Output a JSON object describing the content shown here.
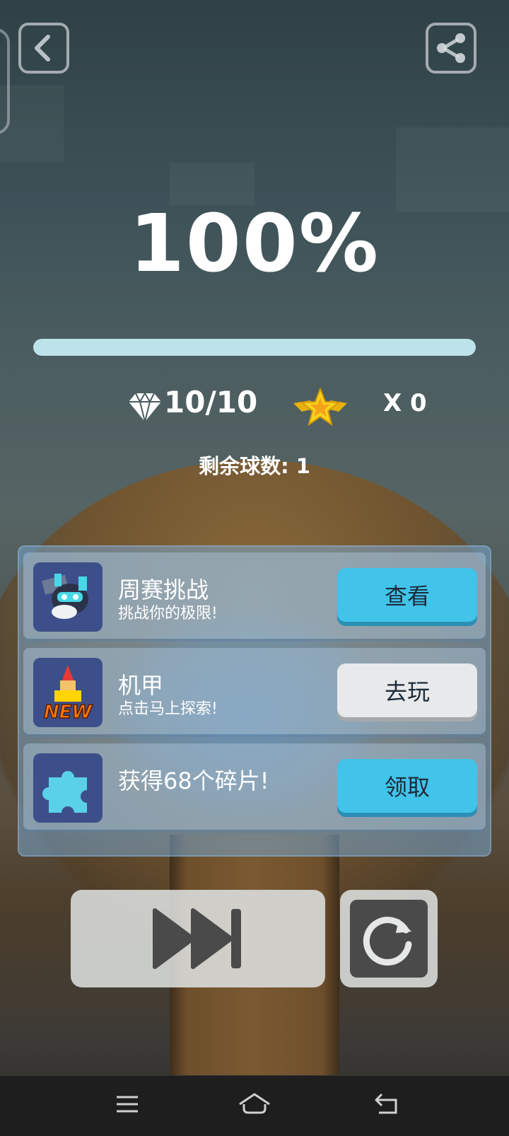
{
  "hud": {
    "back_icon": "back-arrow-icon",
    "share_icon": "share-icon"
  },
  "result": {
    "percent": "100%",
    "progress_fraction": 1.0,
    "gems": "10/10",
    "stars": "X 0",
    "balls_remaining": "剩余球数: 1"
  },
  "tasks": [
    {
      "title": "周赛挑战",
      "subtitle": "挑战你的极限!",
      "button": "查看",
      "icon": "robot-icon",
      "button_style": "blue"
    },
    {
      "title": "机甲",
      "subtitle": "点击马上探索!",
      "button": "去玩",
      "icon": "new-mech-icon",
      "button_style": "gray"
    },
    {
      "title": "获得68个碎片!",
      "subtitle": "",
      "button": "领取",
      "icon": "puzzle-piece-icon",
      "button_style": "blue"
    }
  ],
  "controls": {
    "skip_icon": "fast-forward-icon",
    "retry_icon": "restart-icon"
  },
  "system_nav": {
    "menu_icon": "menu-icon",
    "home_icon": "home-icon",
    "back_icon": "back-icon"
  },
  "colors": {
    "button_blue": "#41c3ea",
    "button_gray": "#e7e9ea",
    "progress_fill": "#bde3ea",
    "star_gold": "#f5c518"
  }
}
